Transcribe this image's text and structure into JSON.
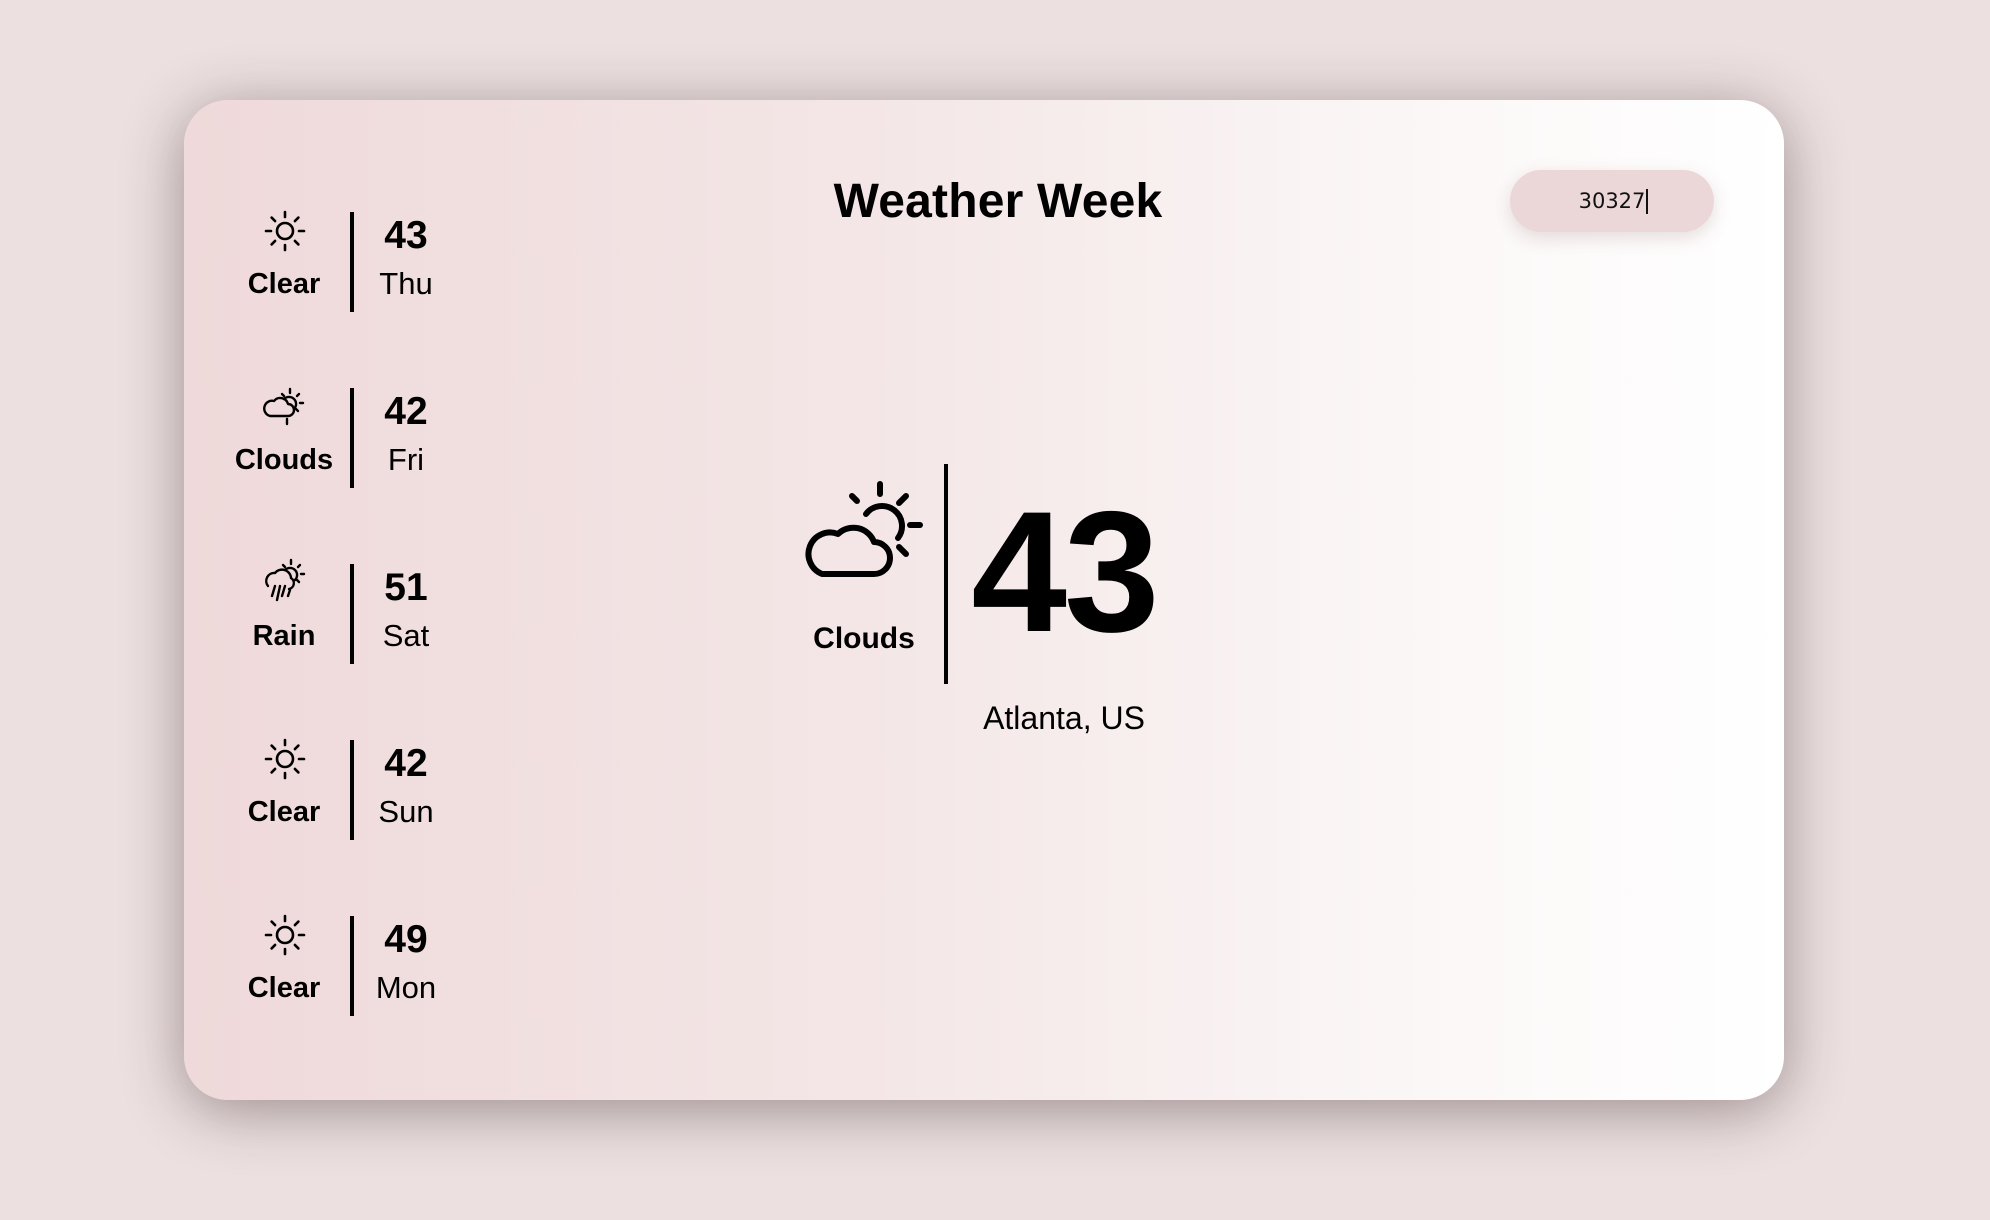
{
  "app": {
    "title": "Weather Week"
  },
  "search": {
    "value": "30327"
  },
  "current": {
    "icon": "cloud-sun-icon",
    "condition": "Clouds",
    "temperature": "43",
    "location": "Atlanta, US"
  },
  "forecast": [
    {
      "icon": "sun-icon",
      "condition": "Clear",
      "temp": "43",
      "day": "Thu"
    },
    {
      "icon": "cloud-sun-icon",
      "condition": "Clouds",
      "temp": "42",
      "day": "Fri"
    },
    {
      "icon": "rain-sun-icon",
      "condition": "Rain",
      "temp": "51",
      "day": "Sat"
    },
    {
      "icon": "sun-icon",
      "condition": "Clear",
      "temp": "42",
      "day": "Sun"
    },
    {
      "icon": "sun-icon",
      "condition": "Clear",
      "temp": "49",
      "day": "Mon"
    }
  ],
  "colors": {
    "page_background": "#ece0e0",
    "search_background": "#ecd7d8",
    "text": "#000000"
  }
}
